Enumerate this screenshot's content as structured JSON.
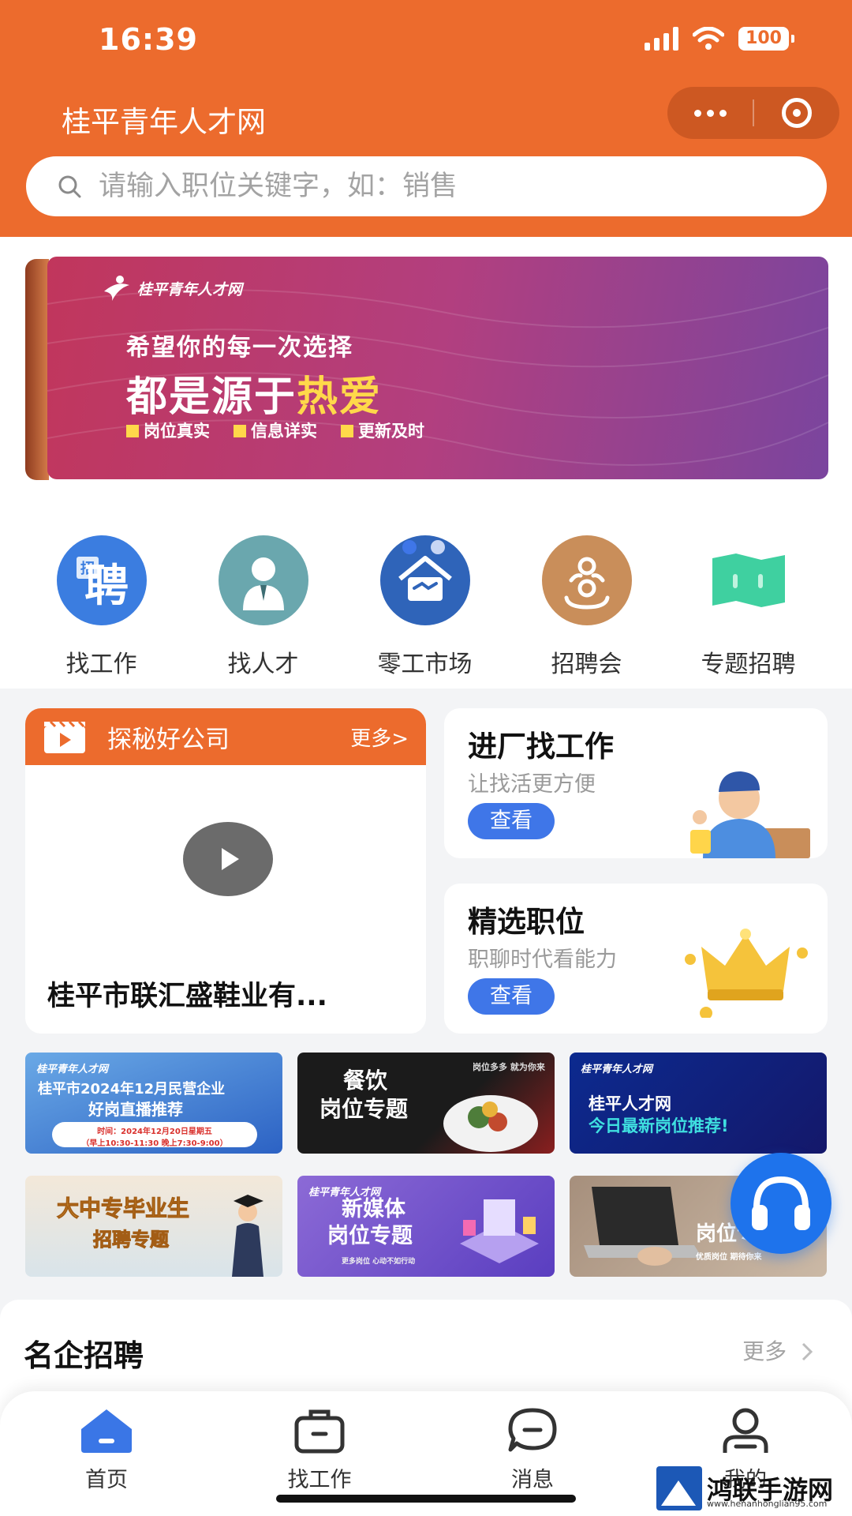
{
  "status_bar": {
    "time": "16:39",
    "battery": "100"
  },
  "app": {
    "title": "桂平青年人才网"
  },
  "search": {
    "placeholder": "请输入职位关键字，如：销售"
  },
  "banner": {
    "logo_text": "桂平青年人才网",
    "line1": "希望你的每一次选择",
    "line2_prefix": "都是源于",
    "line2_highlight": "热爱",
    "tags": [
      "岗位真实",
      "信息详实",
      "更新及时"
    ]
  },
  "categories": [
    {
      "label": "找工作",
      "icon": "pin-recruit-icon",
      "color": "#3b7de0"
    },
    {
      "label": "找人才",
      "icon": "person-suit-icon",
      "color": "#6aa7ae"
    },
    {
      "label": "零工市场",
      "icon": "house-handshake-icon",
      "color": "#2f64b9"
    },
    {
      "label": "招聘会",
      "icon": "group-meeting-icon",
      "color": "#c98e5a"
    },
    {
      "label": "专题招聘",
      "icon": "map-icon",
      "color": "#3fd0a0"
    }
  ],
  "explore": {
    "title": "探秘好公司",
    "more": "更多>",
    "company": "桂平市联汇盛鞋业有..."
  },
  "promos": [
    {
      "title": "进厂找工作",
      "subtitle": "让找活更方便",
      "button": "查看"
    },
    {
      "title": "精选职位",
      "subtitle": "职聊时代看能力",
      "button": "查看"
    }
  ],
  "topics": {
    "t1": {
      "line1": "桂平市2024年12月民营企业",
      "line2": "好岗直播推荐",
      "time": "时间：2024年12月20日星期五",
      "slots": "（早上10:30-11:30  晚上7:30-9:00）"
    },
    "t2": {
      "line1": "餐饮",
      "line2": "岗位专题",
      "tag": "岗位多多 就为你来"
    },
    "t3": {
      "line1": "桂平人才网",
      "line2": "今日最新岗位推荐!"
    },
    "t4": {
      "line1": "大中专毕业生",
      "line2": "招聘专题"
    },
    "t5": {
      "line1": "新媒体",
      "line2": "岗位专题",
      "tag": "更多岗位 心动不如行动"
    },
    "t6": {
      "line2": "岗位专题",
      "tag": "优质岗位 期待你来"
    }
  },
  "famous": {
    "title": "名企招聘",
    "more": "更多"
  },
  "tabbar": [
    {
      "label": "首页",
      "icon": "home-icon",
      "active": true
    },
    {
      "label": "找工作",
      "icon": "briefcase-icon",
      "active": false
    },
    {
      "label": "消息",
      "icon": "message-icon",
      "active": false
    },
    {
      "label": "我的",
      "icon": "user-icon",
      "active": false
    }
  ],
  "watermark": {
    "name": "鸿联手游网",
    "url": "www.henanhonglian95.com"
  },
  "colors": {
    "brand": "#ec6b2d",
    "accent_blue": "#3f76e8"
  }
}
